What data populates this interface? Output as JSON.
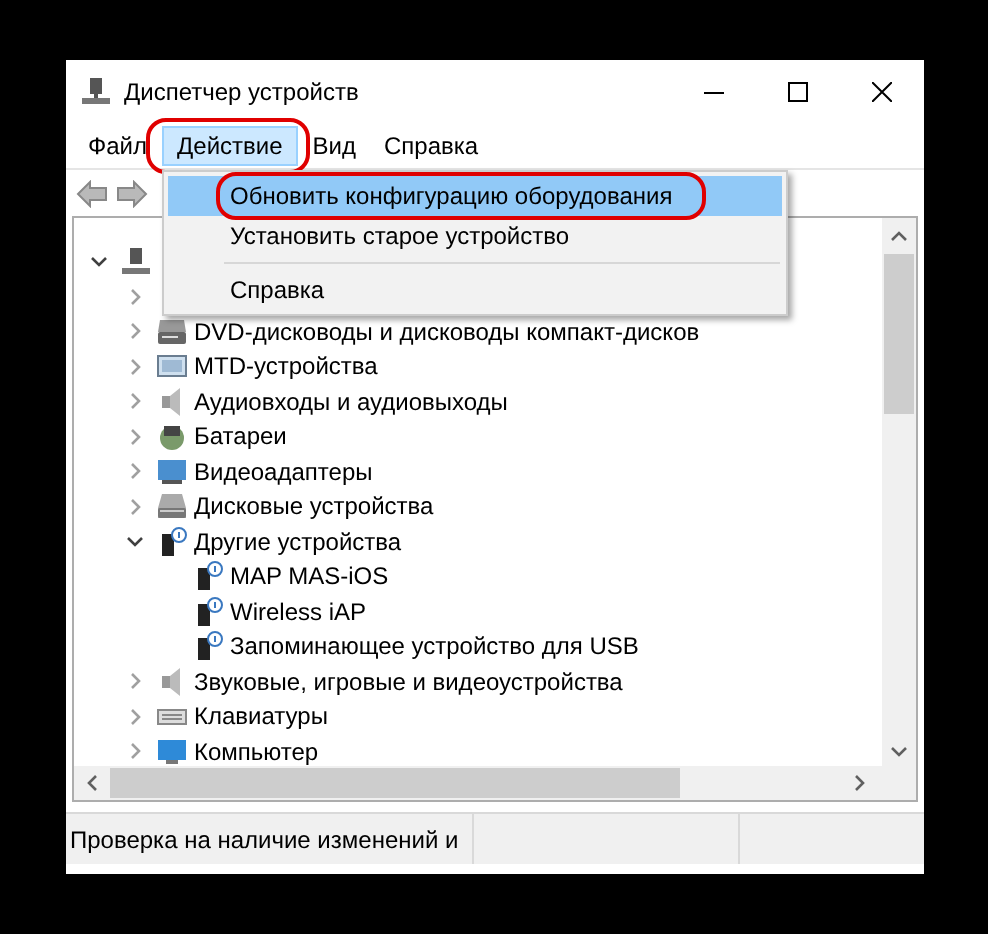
{
  "window": {
    "title": "Диспетчер устройств"
  },
  "menu_bar": [
    {
      "label": "Файл",
      "selected": false,
      "circled": false
    },
    {
      "label": "Действие",
      "selected": true,
      "circled": true
    },
    {
      "label": "Вид",
      "selected": false,
      "circled": false
    },
    {
      "label": "Справка",
      "selected": false,
      "circled": false
    }
  ],
  "dropdown": [
    {
      "kind": "item",
      "label": "Обновить конфигурацию оборудования",
      "selected": true,
      "circled": true
    },
    {
      "kind": "item",
      "label": "Установить старое устройство",
      "selected": false,
      "circled": false
    },
    {
      "kind": "separator"
    },
    {
      "kind": "item",
      "label": "Справка",
      "selected": false,
      "circled": false
    }
  ],
  "tree": [
    {
      "kind": "computer",
      "expanded": true,
      "children": [
        {
          "expanded": false
        },
        {
          "kind": "dvd",
          "label": "DVD-дисководы и дисководы компакт-дисков",
          "expanded": false
        },
        {
          "kind": "mtd",
          "label": "MTD-устройства",
          "expanded": false
        },
        {
          "kind": "audio",
          "label": "Аудиовходы и аудиовыходы",
          "expanded": false
        },
        {
          "kind": "battery",
          "label": "Батареи",
          "expanded": false
        },
        {
          "kind": "display",
          "label": "Видеоадаптеры",
          "expanded": false
        },
        {
          "kind": "disk",
          "label": "Дисковые устройства",
          "expanded": false
        },
        {
          "kind": "unknown",
          "label": "Другие устройства",
          "expanded": true,
          "children": [
            {
              "kind": "unknown",
              "label": "MAP MAS-iOS"
            },
            {
              "kind": "unknown",
              "label": "Wireless iAP"
            },
            {
              "kind": "unknown",
              "label": "Запоминающее устройство для USB"
            }
          ]
        },
        {
          "kind": "audio",
          "label": "Звуковые, игровые и видеоустройства",
          "expanded": false
        },
        {
          "kind": "keyboard",
          "label": "Клавиатуры",
          "expanded": false
        },
        {
          "kind": "monitor",
          "label": "Компьютер",
          "expanded": false
        }
      ]
    }
  ],
  "status_bar": [
    "Проверка на наличие изменений и"
  ]
}
